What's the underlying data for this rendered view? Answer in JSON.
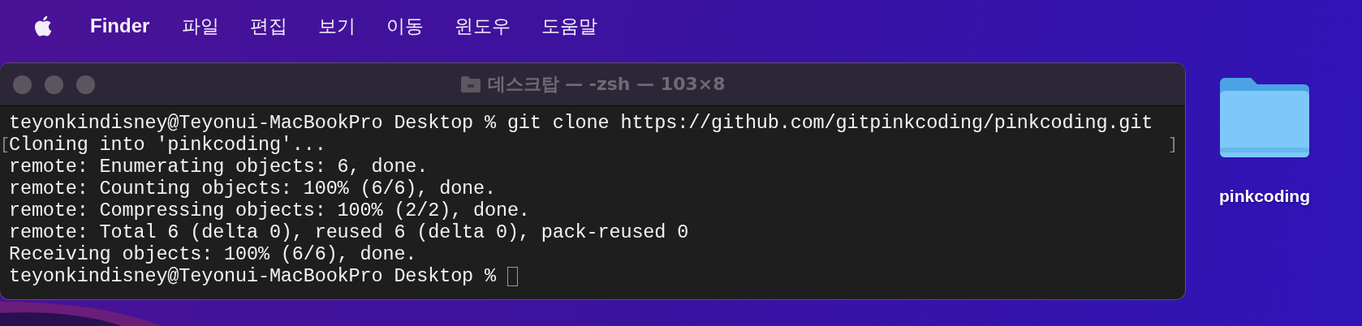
{
  "menu_bar": {
    "app_name": "Finder",
    "items": [
      "파일",
      "편집",
      "보기",
      "이동",
      "윈도우",
      "도움말"
    ]
  },
  "terminal": {
    "title": "데스크탑 — -zsh — 103×8",
    "lines": [
      {
        "text": "teyonkindisney@Teyonui-MacBookPro Desktop % git clone https://github.com/gitpinkcoding/pinkcoding.git",
        "cursor": false
      },
      {
        "text": "Cloning into 'pinkcoding'...",
        "left_mark": "[",
        "right_mark": "]",
        "cursor": false
      },
      {
        "text": "remote: Enumerating objects: 6, done.",
        "cursor": false
      },
      {
        "text": "remote: Counting objects: 100% (6/6), done.",
        "cursor": false
      },
      {
        "text": "remote: Compressing objects: 100% (2/2), done.",
        "cursor": false
      },
      {
        "text": "remote: Total 6 (delta 0), reused 6 (delta 0), pack-reused 0",
        "cursor": false
      },
      {
        "text": "Receiving objects: 100% (6/6), done.",
        "cursor": false
      },
      {
        "text": "teyonkindisney@Teyonui-MacBookPro Desktop %",
        "cursor": true
      }
    ]
  },
  "desktop_icons": [
    {
      "label": "pinkcoding"
    }
  ]
}
